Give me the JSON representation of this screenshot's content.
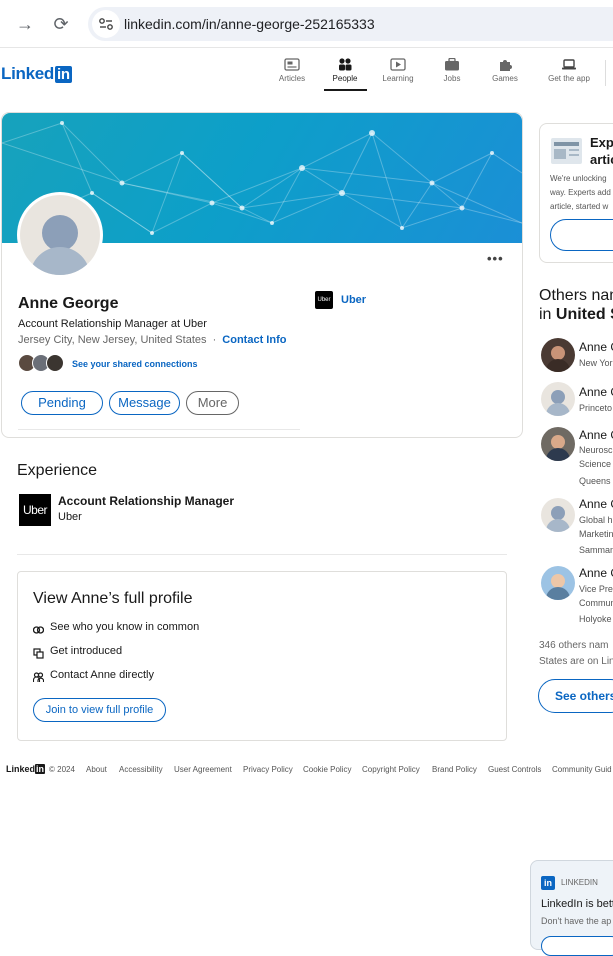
{
  "browser": {
    "url": "linkedin.com/in/anne-george-252165333",
    "back_icon": "arrow-right-icon",
    "reload_icon": "reload-icon"
  },
  "header": {
    "logo_text": "Linked",
    "logo_in": "in",
    "nav": [
      {
        "label": "Articles",
        "icon": "articles-icon"
      },
      {
        "label": "People",
        "icon": "people-icon"
      },
      {
        "label": "Learning",
        "icon": "learning-icon"
      },
      {
        "label": "Jobs",
        "icon": "briefcase-icon"
      },
      {
        "label": "Games",
        "icon": "puzzle-icon"
      },
      {
        "label": "Get the app",
        "icon": "laptop-icon"
      }
    ]
  },
  "profile": {
    "name": "Anne George",
    "headline": "Account Relationship Manager at Uber",
    "location": "Jersey City, New Jersey, United States",
    "separator": "·",
    "contact_info": "Contact Info",
    "shared_connections": "See your shared connections",
    "company_logo_text": "Uber",
    "company_name": "Uber",
    "buttons": {
      "pending": "Pending",
      "message": "Message",
      "more": "More"
    },
    "menu_icon": "•••"
  },
  "experience": {
    "title": "Experience",
    "logo_text": "Uber",
    "role": "Account Relationship Manager",
    "company": "Uber"
  },
  "full_profile": {
    "title": "View Anne’s full profile",
    "items": [
      "See who you know in common",
      "Get introduced",
      "Contact Anne directly"
    ],
    "join_button": "Join to view full profile"
  },
  "footer": {
    "logo_text": "Linked",
    "logo_in": "in",
    "year": "© 2024",
    "links": [
      "About",
      "Accessibility",
      "User Agreement",
      "Privacy Policy",
      "Cookie Policy",
      "Copyright Policy",
      "Brand Policy",
      "Guest Controls",
      "Community Guid"
    ]
  },
  "sidebar": {
    "promo_title_1": "Exp",
    "promo_title_2": "artic",
    "promo_body": [
      "We're unlocking",
      "way. Experts add",
      "article, started w"
    ],
    "others_title_1": "Others nam",
    "others_title_2_prefix": "in ",
    "others_title_2_bold": "United S",
    "people": [
      {
        "name": "Anne G",
        "lines": [
          "New York"
        ]
      },
      {
        "name": "Anne G",
        "lines": [
          "Princeto"
        ]
      },
      {
        "name": "Anne G",
        "lines": [
          "Neurosc",
          "Science",
          "Queens"
        ]
      },
      {
        "name": "Anne G",
        "lines": [
          "Global h",
          "Marketin",
          "Sammam"
        ]
      },
      {
        "name": "Anne G",
        "lines": [
          "Vice Pre",
          "Commun",
          "Holyoke"
        ]
      }
    ],
    "others_count_1": "346 others nam",
    "others_count_2": "States are on Lin",
    "see_others": "See others n"
  },
  "toast": {
    "brand": "LINKEDIN",
    "title": "LinkedIn is bett",
    "body": "Don't have the ap"
  },
  "colors": {
    "brand": "#0a66c2",
    "banner": "#13a3c4"
  }
}
